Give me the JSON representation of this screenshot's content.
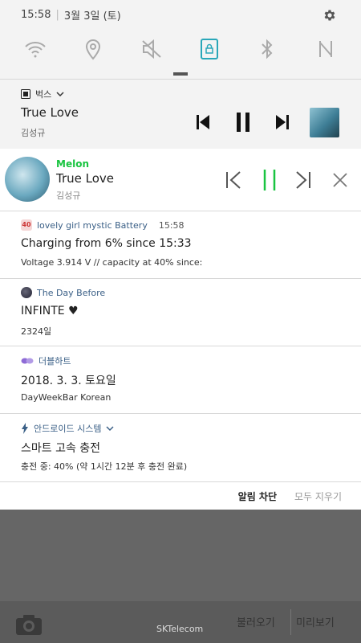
{
  "status_bar": {
    "time": "15:58",
    "date": "3월 3일 (토)"
  },
  "quick_settings": [
    "wifi-icon",
    "location-icon",
    "sound-off-icon",
    "screen-rotation-lock-icon",
    "bluetooth-icon",
    "nfc-icon"
  ],
  "bugs_player": {
    "app_name": "벅스",
    "title": "True Love",
    "artist": "김성규"
  },
  "melon_player": {
    "app_name": "Melon",
    "title": "True Love",
    "artist": "김성규"
  },
  "notifications": [
    {
      "app": "lovely girl mystic Battery",
      "time": "15:58",
      "title": "Charging from 6% since 15:33",
      "text": "Voltage 3.914 V // capacity at 40% since:",
      "badge": "40"
    },
    {
      "app": "The Day Before",
      "title": "INFINTE ♥",
      "text": "2324일"
    },
    {
      "app": "더블하트",
      "title": "2018. 3. 3. 토요일",
      "text": "DayWeekBar Korean"
    },
    {
      "app": "안드로이드 시스템",
      "title": "스마트 고속 충전",
      "text": "충전 중: 40% (약 1시간 12분 후 충전 완료)"
    }
  ],
  "actions": {
    "block": "알림 차단",
    "clear": "모두 지우기"
  },
  "bottom": {
    "carrier": "SKTelecom",
    "left_label": "불러오기",
    "right_label": "미리보기"
  },
  "colors": {
    "melon_green": "#19c440",
    "accent_teal": "#2aa7b9"
  }
}
